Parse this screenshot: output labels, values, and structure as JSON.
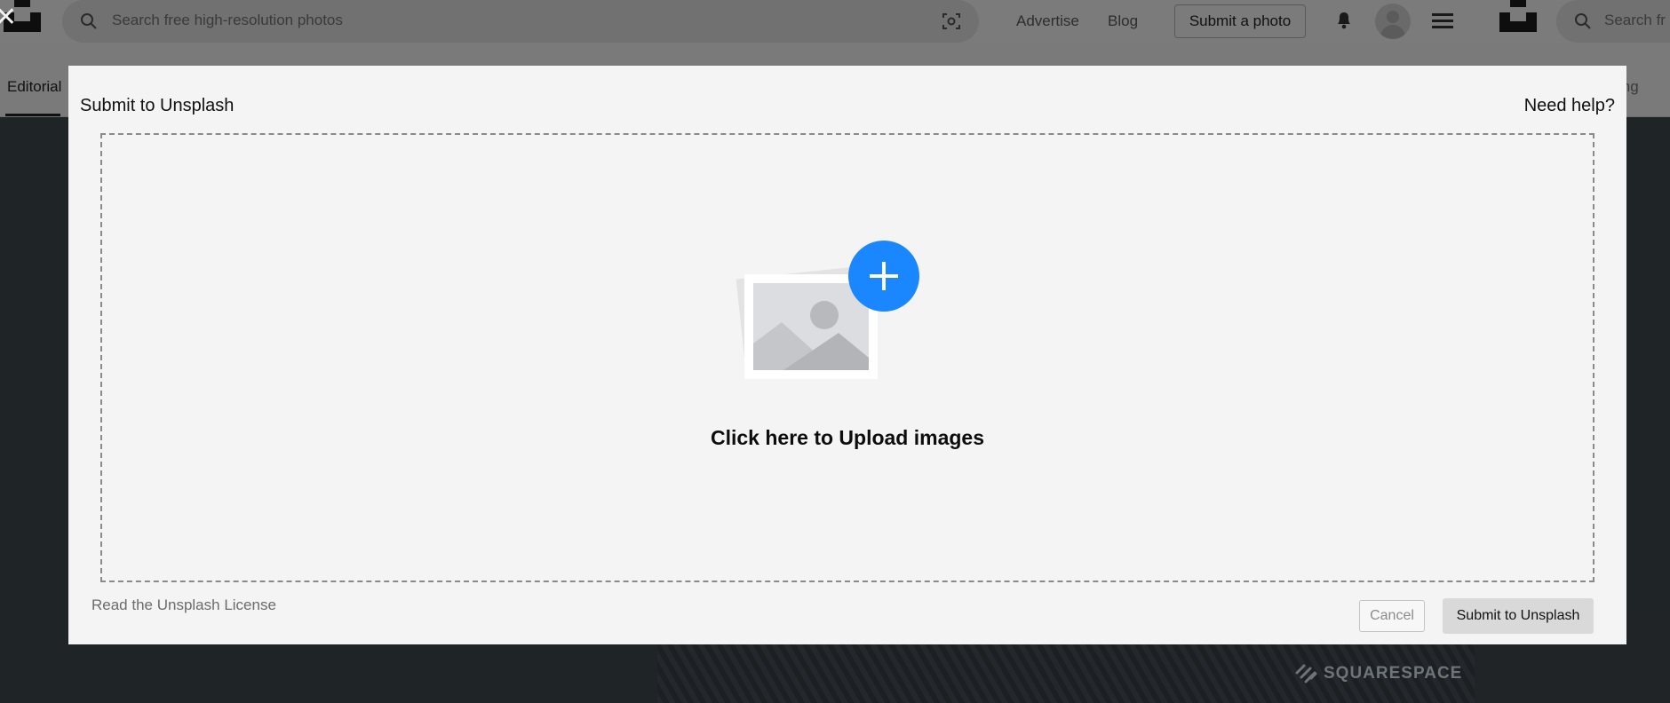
{
  "header": {
    "search_placeholder": "Search free high-resolution photos",
    "nav_advertise": "Advertise",
    "nav_blog": "Blog",
    "submit_photo": "Submit a photo",
    "search_placeholder_right": "Search fr"
  },
  "subnav": {
    "editorial": "Editorial",
    "right_fragment": "ing"
  },
  "background": {
    "sponsor": "SQUARESPACE"
  },
  "modal": {
    "title": "Submit to Unsplash",
    "help": "Need help?",
    "upload_cta": "Click here to Upload images",
    "license_link": "Read the Unsplash License",
    "cancel": "Cancel",
    "submit": "Submit to Unsplash"
  },
  "icons": {
    "close": "close-icon",
    "search": "search-icon",
    "visual_search": "visual-search-icon",
    "notifications": "bell-icon",
    "menu": "menu-icon",
    "upload": "add-image-icon"
  },
  "colors": {
    "accent_blue": "#1a86ff",
    "modal_bg": "#f4f4f4",
    "overlay": "#7b7b7b"
  }
}
